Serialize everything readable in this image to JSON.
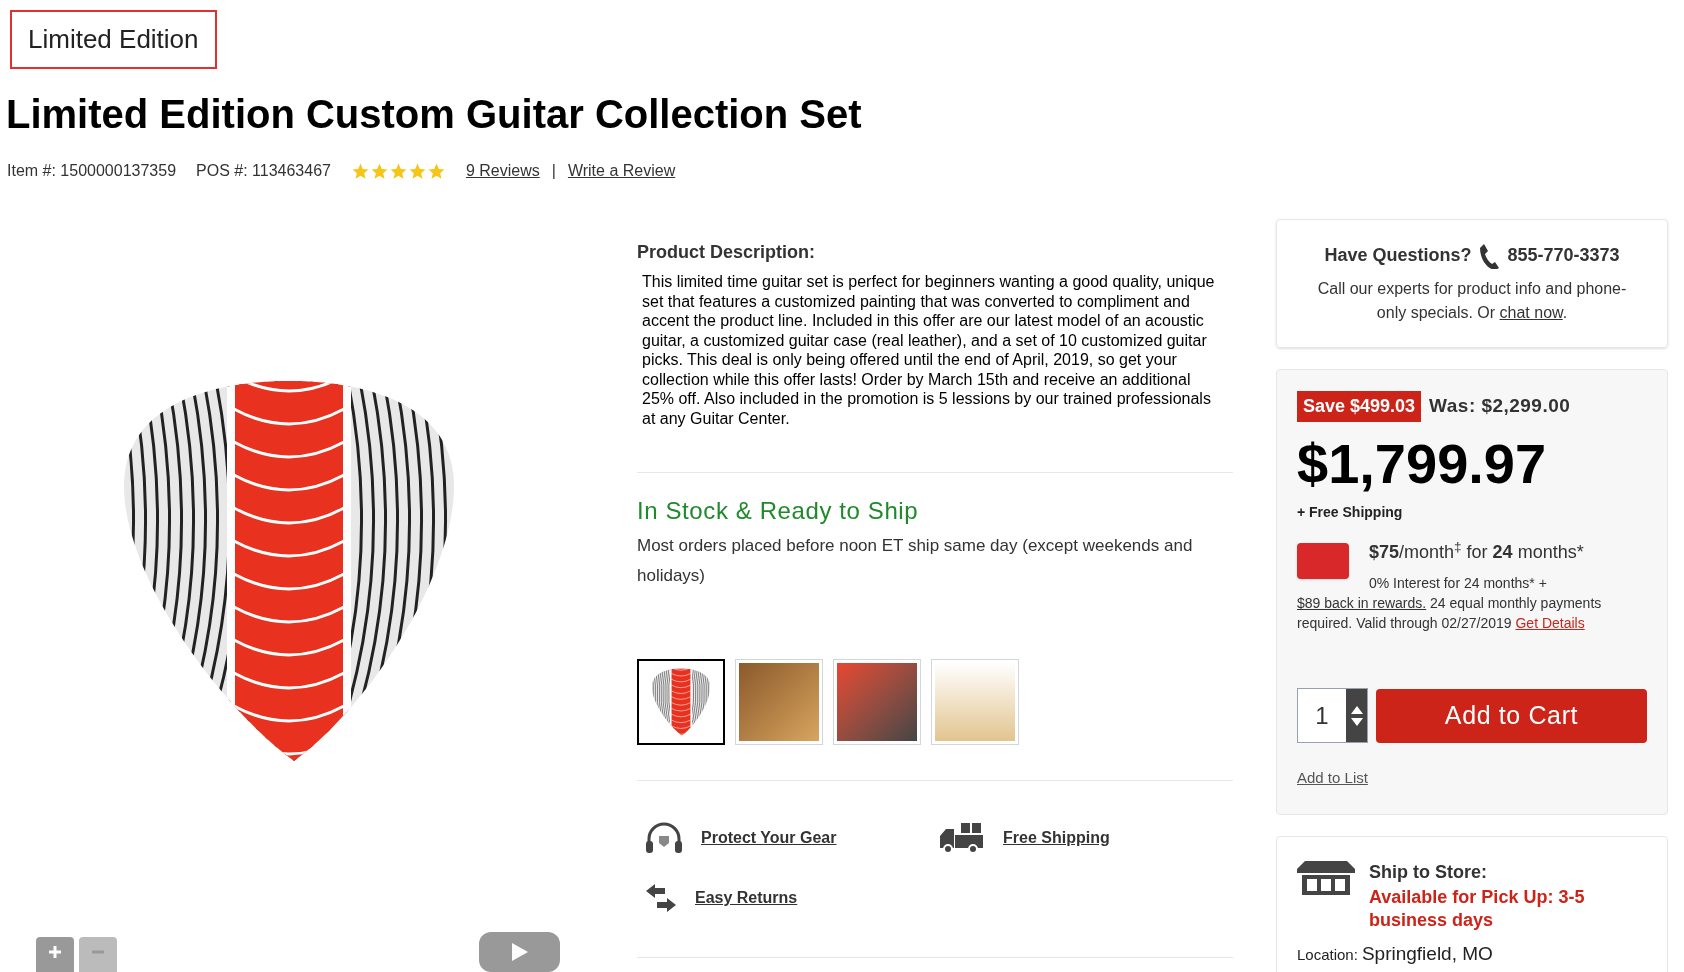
{
  "badge": "Limited Edition",
  "title": "Limited Edition Custom Guitar Collection Set",
  "meta": {
    "item": "Item #: 1500000137359",
    "pos": "POS #: 113463467",
    "stars": 5,
    "reviews_link": "9 Reviews",
    "separator": "|",
    "write_review_link": "Write a Review"
  },
  "description": {
    "heading": "Product Description:",
    "text": "This limited time guitar set is perfect for beginners wanting a good quality, unique set that features a customized painting that was converted to compliment and accent the product line. Included in this offer are our latest model of an acoustic guitar, a customized guitar case (real leather), and a set of 10 customized guitar picks. This deal is only being offered until the end of April, 2019, so get your collection while this offer lasts! Order by March 15th and receive an additional 25% off. Also included in the promotion is 5 lessions by our trained professionals at any Guitar Center."
  },
  "stock": {
    "heading": "In Stock & Ready to Ship",
    "note": "Most orders placed before noon ET ship same day (except weekends and holidays)"
  },
  "thumbnails": [
    {
      "kind": "pick",
      "selected": true
    },
    {
      "kind": "showroom",
      "selected": false
    },
    {
      "kind": "case",
      "selected": false
    },
    {
      "kind": "guitar",
      "selected": false
    }
  ],
  "features": [
    {
      "kind": "protect",
      "label": "Protect Your Gear"
    },
    {
      "kind": "shipping",
      "label": "Free Shipping"
    },
    {
      "kind": "returns",
      "label": "Easy Returns"
    }
  ],
  "questions": {
    "heading": "Have Questions?",
    "phone": "855-770-3373",
    "text": "Call our experts for product info and phone-only specials. Or ",
    "link": "chat now",
    "end": "."
  },
  "pricing": {
    "save": "Save $499.03",
    "was": "Was: $2,299.00",
    "price": "$1,799.97",
    "shipping": "+ Free Shipping",
    "monthly": "**$75**/month$^{‡}$ for **24** months*",
    "finance_text": "0% Interest for 24 months* + ",
    "rewards_link": "$89 back in rewards.",
    "finance_text_2": " 24 equal monthly payments required. Valid through 02/27/2019 ",
    "details_link": "Get Details",
    "quantity": "1",
    "add_to_cart": "Add to Cart",
    "add_to_list": "Add to List"
  },
  "store": {
    "heading": "Ship to Store:",
    "availability": "Available for Pick Up: 3-5 business days",
    "location_label": "Location:",
    "location": "Springfield, MO"
  }
}
